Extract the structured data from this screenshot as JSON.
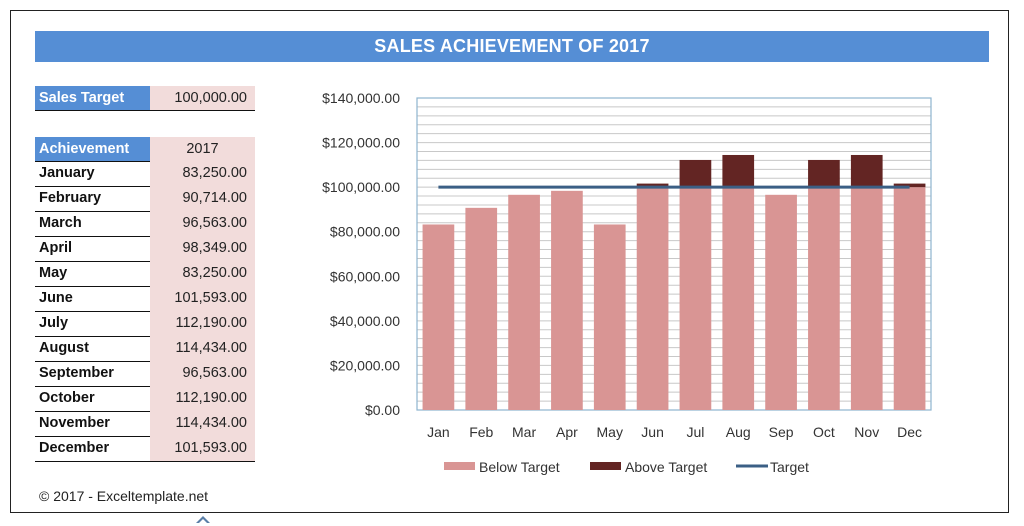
{
  "title": "SALES ACHIEVEMENT OF 2017",
  "sales_target": {
    "label": "Sales Target",
    "value": "100,000.00"
  },
  "achievement": {
    "header_label": "Achievement",
    "header_year": "2017",
    "rows": [
      {
        "month": "January",
        "value": "83,250.00"
      },
      {
        "month": "February",
        "value": "90,714.00"
      },
      {
        "month": "March",
        "value": "96,563.00"
      },
      {
        "month": "April",
        "value": "98,349.00"
      },
      {
        "month": "May",
        "value": "83,250.00"
      },
      {
        "month": "June",
        "value": "101,593.00"
      },
      {
        "month": "July",
        "value": "112,190.00"
      },
      {
        "month": "August",
        "value": "114,434.00"
      },
      {
        "month": "September",
        "value": "96,563.00"
      },
      {
        "month": "October",
        "value": "112,190.00"
      },
      {
        "month": "November",
        "value": "114,434.00"
      },
      {
        "month": "December",
        "value": "101,593.00"
      }
    ]
  },
  "footer": "© 2017 - Exceltemplate.net",
  "colors": {
    "title_bg": "#558ed5",
    "cell_fill": "#f2dcdb",
    "below_target": "#d99594",
    "above_target": "#632523",
    "target_line": "#3b5f85",
    "gridline": "#c8c8c8",
    "plot_border": "#8eb4cf"
  },
  "chart_data": {
    "type": "bar",
    "stacked": true,
    "title": "",
    "xlabel": "",
    "ylabel": "",
    "categories": [
      "Jan",
      "Feb",
      "Mar",
      "Apr",
      "May",
      "Jun",
      "Jul",
      "Aug",
      "Sep",
      "Oct",
      "Nov",
      "Dec"
    ],
    "series": [
      {
        "name": "Below Target",
        "type": "bar",
        "values": [
          83250,
          90714,
          96563,
          98349,
          83250,
          100000,
          100000,
          100000,
          96563,
          100000,
          100000,
          100000
        ]
      },
      {
        "name": "Above Target",
        "type": "bar",
        "values": [
          0,
          0,
          0,
          0,
          0,
          1593,
          12190,
          14434,
          0,
          12190,
          14434,
          1593
        ]
      },
      {
        "name": "Target",
        "type": "line",
        "values": [
          100000,
          100000,
          100000,
          100000,
          100000,
          100000,
          100000,
          100000,
          100000,
          100000,
          100000,
          100000
        ]
      }
    ],
    "ylim": [
      0,
      140000
    ],
    "yticks": [
      0,
      20000,
      40000,
      60000,
      80000,
      100000,
      120000,
      140000
    ],
    "ytick_labels": [
      "$0.00",
      "$20,000.00",
      "$40,000.00",
      "$60,000.00",
      "$80,000.00",
      "$100,000.00",
      "$120,000.00",
      "$140,000.00"
    ],
    "minor_grid_step": 4000,
    "grid": true,
    "legend": {
      "position": "bottom",
      "entries": [
        "Below Target",
        "Above Target",
        "Target"
      ]
    }
  }
}
